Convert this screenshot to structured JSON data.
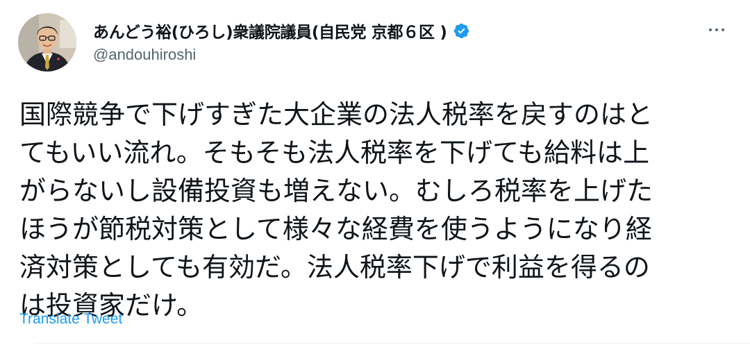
{
  "author": {
    "display_name": "あんどう裕(ひろし)衆議院議員(自民党 京都６区 )",
    "handle": "@andouhiroshi",
    "verified": true,
    "avatar_icon": "user-avatar"
  },
  "tweet": {
    "lines": [
      "国際競争で下げすぎた大企業の法人税率を戻すのはと",
      "てもいい流れ。そもそも法人税率を下げても給料は上",
      "がらないし設備投資も増えない。むしろ税率を上げた",
      "ほうが節税対策として様々な経費を使うようになり経",
      "済対策としても有効だ。法人税率下げで利益を得るの",
      "は投資家だけ。"
    ]
  },
  "actions": {
    "translate_label": "Translate Tweet",
    "more_icon": "more-icon"
  },
  "colors": {
    "text": "#0f1419",
    "secondary": "#536471",
    "accent": "#1d9bf0"
  }
}
